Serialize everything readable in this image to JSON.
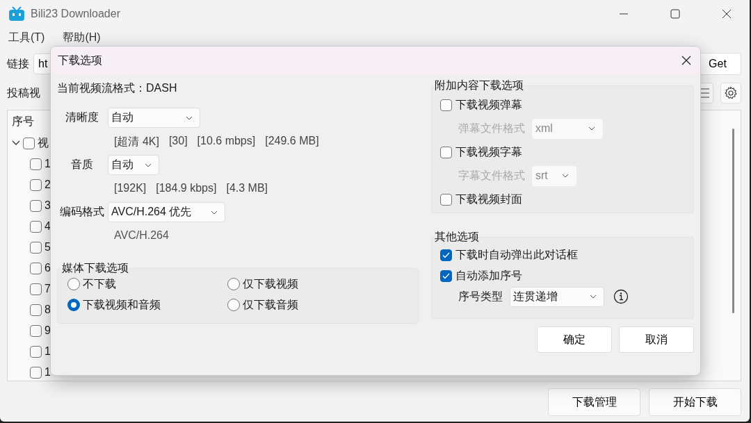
{
  "window": {
    "title": "Bili23 Downloader"
  },
  "menu": [
    {
      "label": "工具(T)"
    },
    {
      "label": "帮助(H)"
    }
  ],
  "link": {
    "label": "链接",
    "value": "ht",
    "button": "Get"
  },
  "section_label": "投稿视",
  "tree": {
    "column_1": "序号",
    "root": {
      "label": "视",
      "expanded": true,
      "checked": false,
      "children": [
        {
          "label": "1",
          "checked": false
        },
        {
          "label": "2",
          "checked": false
        },
        {
          "label": "3",
          "checked": false
        },
        {
          "label": "4",
          "checked": false
        },
        {
          "label": "5",
          "checked": false
        },
        {
          "label": "6",
          "checked": false
        },
        {
          "label": "7",
          "checked": false
        },
        {
          "label": "8",
          "checked": false
        },
        {
          "label": "9",
          "checked": false
        },
        {
          "label": "1",
          "checked": false
        },
        {
          "label": "1",
          "checked": false
        }
      ]
    }
  },
  "bottom_buttons": [
    "下载管理",
    "开始下载"
  ],
  "dialog": {
    "title": "下载选项",
    "stream_format": "当前视频流格式：DASH",
    "streams": [
      {
        "label": "清晰度",
        "value": "自动",
        "info": [
          "[超清 4K]",
          "[30]",
          "[10.6 mbps]",
          "[249.6 MB]"
        ],
        "kind": "wide"
      },
      {
        "label": "音质",
        "value": "自动",
        "info": [
          "[192K]",
          "[184.9 kbps]",
          "[4.3 MB]"
        ],
        "kind": "narrow"
      },
      {
        "label": "编码格式",
        "value": "AVC/H.264 优先",
        "info": [
          "AVC/H.264"
        ],
        "kind": "medium"
      }
    ],
    "media_group": {
      "title": "媒体下载选项",
      "options": [
        {
          "label": "不下载",
          "selected": false
        },
        {
          "label": "仅下载视频",
          "selected": false
        },
        {
          "label": "下载视频和音频",
          "selected": true
        },
        {
          "label": "仅下载音频",
          "selected": false
        }
      ]
    },
    "extra_group": {
      "title": "附加内容下载选项",
      "items": [
        {
          "kind": "checkbox",
          "label": "下载视频弹幕",
          "checked": false
        },
        {
          "kind": "select",
          "label": "弹幕文件格式",
          "value": "xml",
          "disabled": true
        },
        {
          "kind": "checkbox",
          "label": "下载视频字幕",
          "checked": false
        },
        {
          "kind": "select",
          "label": "字幕文件格式",
          "value": "srt",
          "disabled": true
        },
        {
          "kind": "checkbox",
          "label": "下载视频封面",
          "checked": false
        }
      ]
    },
    "other_group": {
      "title": "其他选项",
      "items": [
        {
          "kind": "checkbox",
          "label": "下载时自动弹出此对话框",
          "checked": true
        },
        {
          "kind": "checkbox",
          "label": "自动添加序号",
          "checked": true
        },
        {
          "kind": "select-help",
          "label": "序号类型",
          "value": "连贯递增",
          "disabled": false
        }
      ]
    },
    "buttons": [
      "确定",
      "取消"
    ]
  }
}
